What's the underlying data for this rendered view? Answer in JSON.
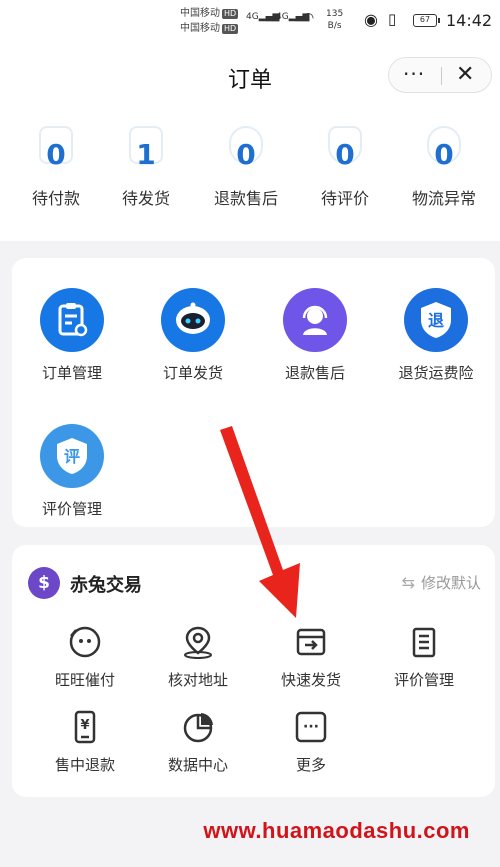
{
  "status_bar": {
    "carrier1": "中国移动",
    "carrier2": "中国移动",
    "hd": "HD",
    "net1": "4G",
    "net2": "4G",
    "speed_value": "135",
    "speed_unit": "B/s",
    "battery": "67",
    "time": "14:42"
  },
  "header": {
    "title": "订单",
    "more_icon": "···",
    "close_icon": "✕"
  },
  "order_status": [
    {
      "count": "0",
      "label": "待付款"
    },
    {
      "count": "1",
      "label": "待发货"
    },
    {
      "count": "0",
      "label": "退款售后"
    },
    {
      "count": "0",
      "label": "待评价"
    },
    {
      "count": "0",
      "label": "物流异常"
    }
  ],
  "services": [
    {
      "label": "订单管理",
      "icon": "clipboard-icon",
      "color": "#1677e5"
    },
    {
      "label": "订单发货",
      "icon": "robot-icon",
      "color": "#1677e5"
    },
    {
      "label": "退款售后",
      "icon": "headset-icon",
      "color": "#6f55e8"
    },
    {
      "label": "退货运费险",
      "icon": "shield-icon",
      "color": "#1d6fe0",
      "glyph": "退"
    },
    {
      "label": "评价管理",
      "icon": "shield-review-icon",
      "color": "#3c98e6",
      "glyph": "评"
    }
  ],
  "chitu": {
    "logo_glyph": "$",
    "name": "赤兔交易",
    "edit_label": "修改默认",
    "tools": [
      {
        "label": "旺旺催付",
        "icon": "wangwang-icon"
      },
      {
        "label": "核对地址",
        "icon": "location-icon"
      },
      {
        "label": "快速发货",
        "icon": "box-icon"
      },
      {
        "label": "评价管理",
        "icon": "review-list-icon"
      },
      {
        "label": "售中退款",
        "icon": "refund-phone-icon",
        "glyph": "¥"
      },
      {
        "label": "数据中心",
        "icon": "pie-chart-icon"
      },
      {
        "label": "更多",
        "icon": "more-icon",
        "glyph": "···"
      }
    ]
  },
  "watermark": "www.huamaodashu.com",
  "colors": {
    "accent_blue": "#1e6fd0",
    "arrow_red": "#e8241c",
    "purple": "#6c48c9"
  }
}
